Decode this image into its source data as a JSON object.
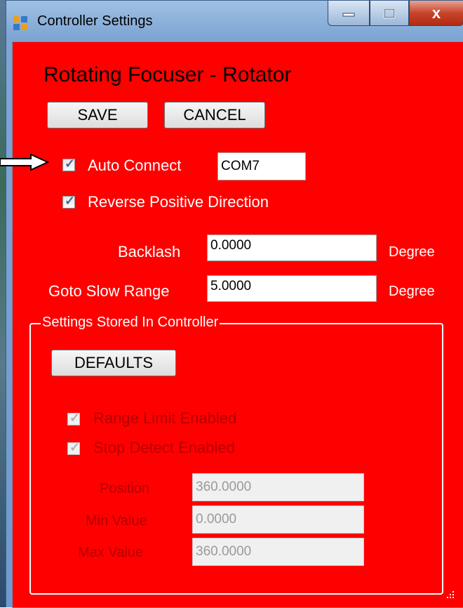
{
  "window": {
    "title": "Controller Settings",
    "close_glyph": "x"
  },
  "heading": "Rotating Focuser - Rotator",
  "buttons": {
    "save": "SAVE",
    "cancel": "CANCEL",
    "defaults": "DEFAULTS"
  },
  "auto_connect": {
    "label": "Auto Connect",
    "checked": true,
    "port": "COM7"
  },
  "reverse_direction": {
    "label": "Reverse Positive Direction",
    "checked": true
  },
  "backlash": {
    "label": "Backlash",
    "value": "0.0000",
    "unit": "Degree"
  },
  "goto_slow_range": {
    "label": "Goto Slow Range",
    "value": "5.0000",
    "unit": "Degree"
  },
  "controller_group": {
    "title": "Settings Stored In Controller",
    "range_limit": {
      "label": "Range Limit Enabled",
      "checked": true
    },
    "stop_detect": {
      "label": "Stop Detect Enabled",
      "checked": true
    },
    "position": {
      "label": "Position",
      "value": "360.0000"
    },
    "min_value": {
      "label": "Min Value",
      "value": "0.0000"
    },
    "max_value": {
      "label": "Max Value",
      "value": "360.0000"
    }
  },
  "colors": {
    "client_background": "#ff0000",
    "label_text": "#ffffff",
    "disabled_label": "#b30000"
  },
  "icons": {
    "app": "form-icon",
    "minimize": "minimize-icon",
    "maximize": "maximize-icon",
    "close": "close-icon",
    "check": "checkmark-icon",
    "pointer": "arrow-right-icon"
  }
}
